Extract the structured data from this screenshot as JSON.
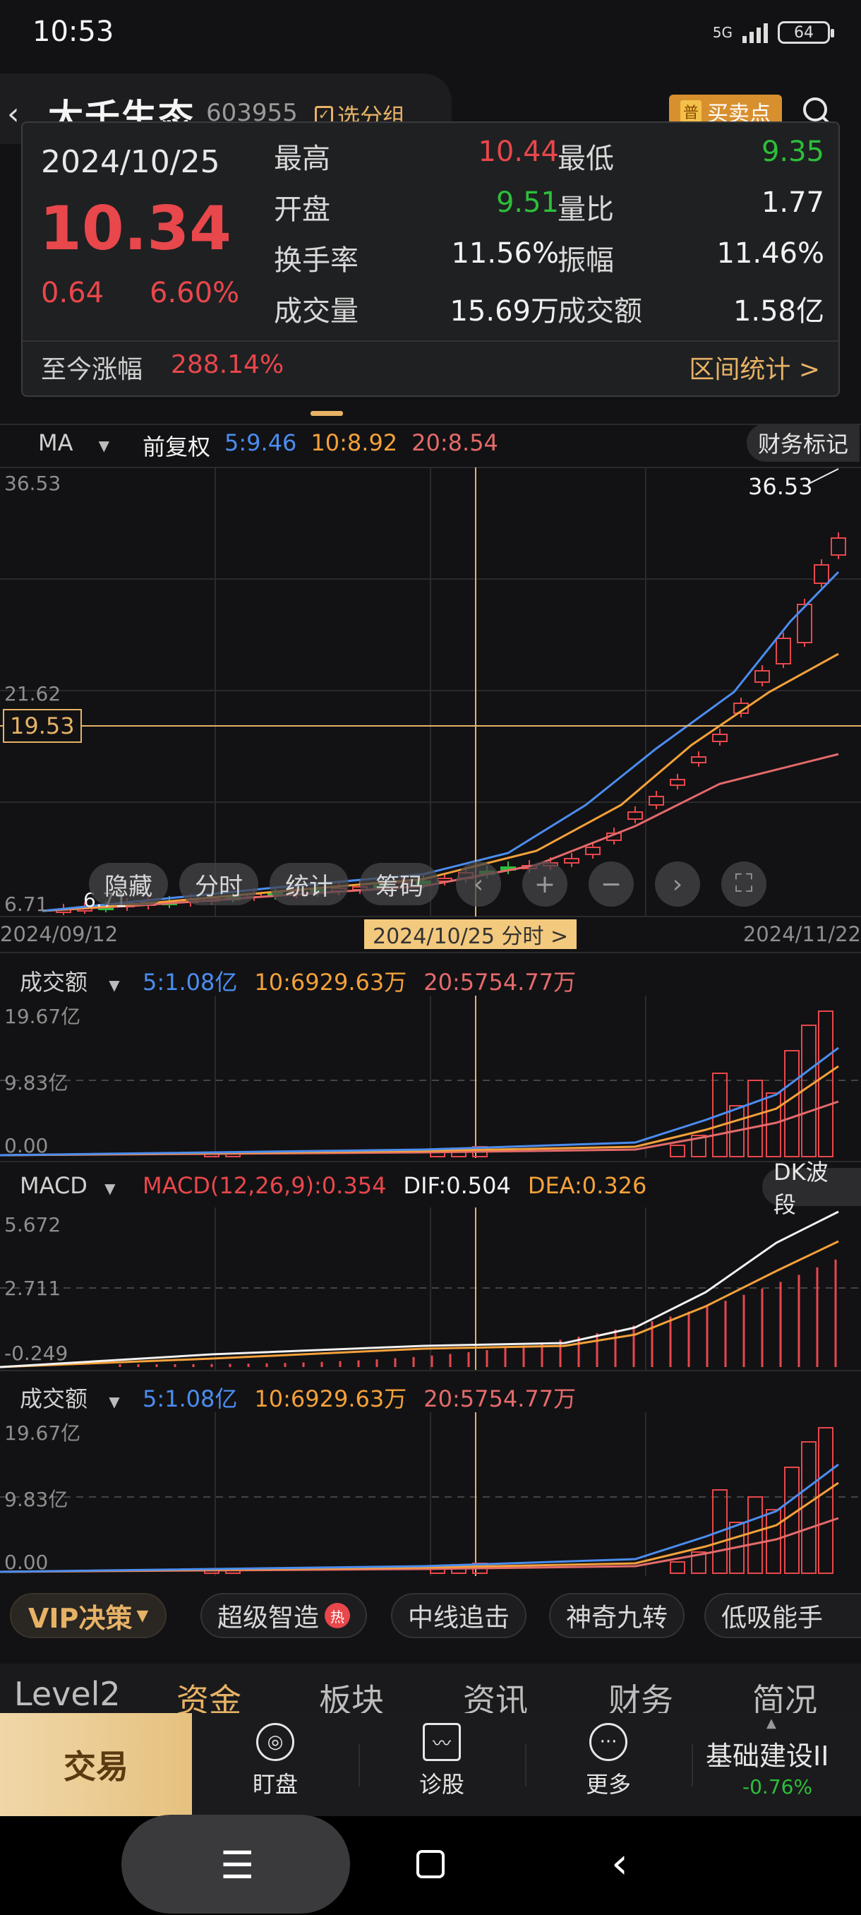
{
  "status_bar": {
    "time": "10:53",
    "network": "5G",
    "battery": "64"
  },
  "header": {
    "stock_name": "大千生态",
    "stock_code": "603955",
    "group_label": "选分组",
    "buysell_badge": "普",
    "buysell_label": "买卖点"
  },
  "tooltip": {
    "date": "2024/10/25",
    "price": "10.34",
    "change": "0.64",
    "change_pct": "6.60%",
    "stats": [
      {
        "label": "最高",
        "value": "10.44",
        "color": "red"
      },
      {
        "label": "最低",
        "value": "9.35",
        "color": "green"
      },
      {
        "label": "开盘",
        "value": "9.51",
        "color": "green"
      },
      {
        "label": "量比",
        "value": "1.77",
        "color": "white"
      },
      {
        "label": "换手率",
        "value": "11.56%",
        "color": "white"
      },
      {
        "label": "振幅",
        "value": "11.46%",
        "color": "white"
      },
      {
        "label": "成交量",
        "value": "15.69万",
        "color": "white"
      },
      {
        "label": "成交额",
        "value": "1.58亿",
        "color": "white"
      }
    ],
    "since_label": "至今涨幅",
    "since_value": "288.14%",
    "range_stats": "区间统计 >"
  },
  "ma": {
    "selector": "MA",
    "adjust": "前复权",
    "ma5": "5:9.46",
    "ma10": "10:8.92",
    "ma20": "20:8.54",
    "fin_marks": "财务标记"
  },
  "main_chart": {
    "y_top": "36.53",
    "y_mid": "21.62",
    "y_low": "6.71",
    "crosshair_price": "19.53",
    "max_label": "36.53",
    "min_label": "6.71",
    "buttons": [
      "隐藏",
      "分时",
      "统计",
      "筹码"
    ]
  },
  "dates": {
    "start": "2024/09/12",
    "selected": "2024/10/25 分时 >",
    "end": "2024/11/22"
  },
  "amount1": {
    "title": "成交额",
    "v5": "5:1.08亿",
    "v10": "10:6929.63万",
    "v20": "20:5754.77万",
    "y_top": "19.67亿",
    "y_mid": "9.83亿",
    "y_low": "0.00"
  },
  "macd": {
    "title": "MACD",
    "macd": "MACD(12,26,9):0.354",
    "dif": "DIF:0.504",
    "dea": "DEA:0.326",
    "dk": "DK波段",
    "y_top": "5.672",
    "y_mid": "2.711",
    "y_low": "-0.249"
  },
  "amount2": {
    "title": "成交额",
    "v5": "5:1.08亿",
    "v10": "10:6929.63万",
    "v20": "20:5754.77万",
    "y_top": "19.67亿",
    "y_mid": "9.83亿",
    "y_low": "0.00"
  },
  "strategies": {
    "vip": "VIP决策",
    "chips": [
      "超级智造",
      "中线追击",
      "神奇九转",
      "低吸能手"
    ],
    "hot_badge": "热"
  },
  "tabs": [
    "Level2",
    "资金",
    "板块",
    "资讯",
    "财务",
    "简况"
  ],
  "toolbar": {
    "trade": "交易",
    "items": [
      "盯盘",
      "诊股",
      "更多"
    ],
    "sector_name": "基础建设II",
    "sector_change": "-0.76%"
  },
  "colors": {
    "up": "#e8474b",
    "down": "#2cbf3a",
    "ma5": "#4b8df0",
    "ma10": "#f4a13a",
    "ma20": "#e56a6a",
    "accent": "#e7b266"
  }
}
